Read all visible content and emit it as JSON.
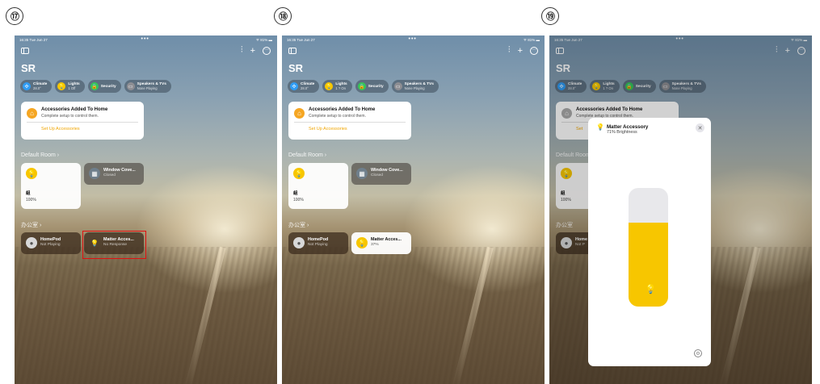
{
  "steps": [
    "⑰",
    "⑱",
    "⑲"
  ],
  "status": {
    "time": "16:35  Tue Jun 27",
    "dots": "•••",
    "battery": "ᯤ 81% ▬"
  },
  "home": {
    "title": "SR",
    "chips": [
      {
        "label": "Climate",
        "sub": "28.0°",
        "icon_color": "#2f9cf4"
      },
      {
        "label": "Lights",
        "sub": "1 Off",
        "sub_on": "1 ? On",
        "icon_color": "#f7c600"
      },
      {
        "label": "Security",
        "sub": "",
        "icon_color": "#34c759"
      },
      {
        "label": "Speakers & TVs",
        "sub": "None Playing",
        "icon_color": "#8e8e93"
      }
    ],
    "notification": {
      "title": "Accessories Added To Home",
      "subtitle": "Complete setup to control them.",
      "link": "Set Up Accessories",
      "link_short": "Set"
    },
    "room1": "Default Room",
    "room2": "办公室",
    "tiles": {
      "light_name": "組",
      "light_status": "100%",
      "window_name": "Window Cove...",
      "window_status": "Closed",
      "homepod_name": "HomePod",
      "homepod_status": "Not Playing",
      "homepod_name_short": "Home",
      "homepod_status_short": "Not P",
      "matter_name": "Matter Acces...",
      "matter_status_a": "No Response",
      "matter_status_b": "37%"
    }
  },
  "sheet": {
    "title": "Matter Accessory",
    "subtitle": "71% Brightness",
    "brightness": 0.71
  },
  "icons": {
    "sidebar": "sidebar-icon",
    "waveform": "waveform-icon",
    "add": "plus-icon",
    "more": "ellipsis-icon",
    "bulb": "lightbulb-icon",
    "close": "close-icon",
    "gear": "gear-icon"
  },
  "colors": {
    "accent": "#f0a500",
    "light_on": "#f7c600",
    "highlight": "#e01010"
  }
}
